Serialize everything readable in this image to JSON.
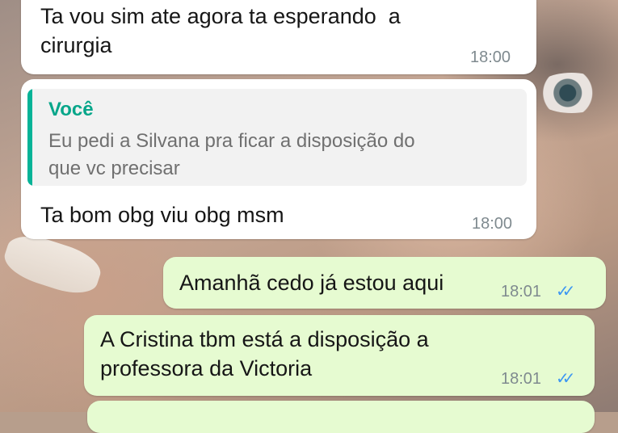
{
  "messages": [
    {
      "direction": "incoming",
      "text": "Ta vou sim ate agora ta esperando  a\ncirurgia",
      "time": "18:00"
    },
    {
      "direction": "incoming",
      "quote": {
        "author": "Você",
        "text": "Eu pedi a Silvana pra ficar a disposição do\nque vc precisar"
      },
      "text": "Ta bom obg viu obg msm",
      "time": "18:00"
    },
    {
      "direction": "outgoing",
      "text": "Amanhã cedo já estou aqui",
      "time": "18:01",
      "status": "read"
    },
    {
      "direction": "outgoing",
      "text": "A Cristina tbm está a disposição a\nprofessora da Victoria",
      "time": "18:01",
      "status": "read"
    }
  ],
  "colors": {
    "incoming_bubble": "#ffffff",
    "outgoing_bubble": "#e6fbd1",
    "quote_accent": "#06b397",
    "read_ticks": "#3e97f2"
  },
  "icons": {
    "read_receipt": "double-check-icon"
  },
  "ticks_glyph": "✓✓"
}
